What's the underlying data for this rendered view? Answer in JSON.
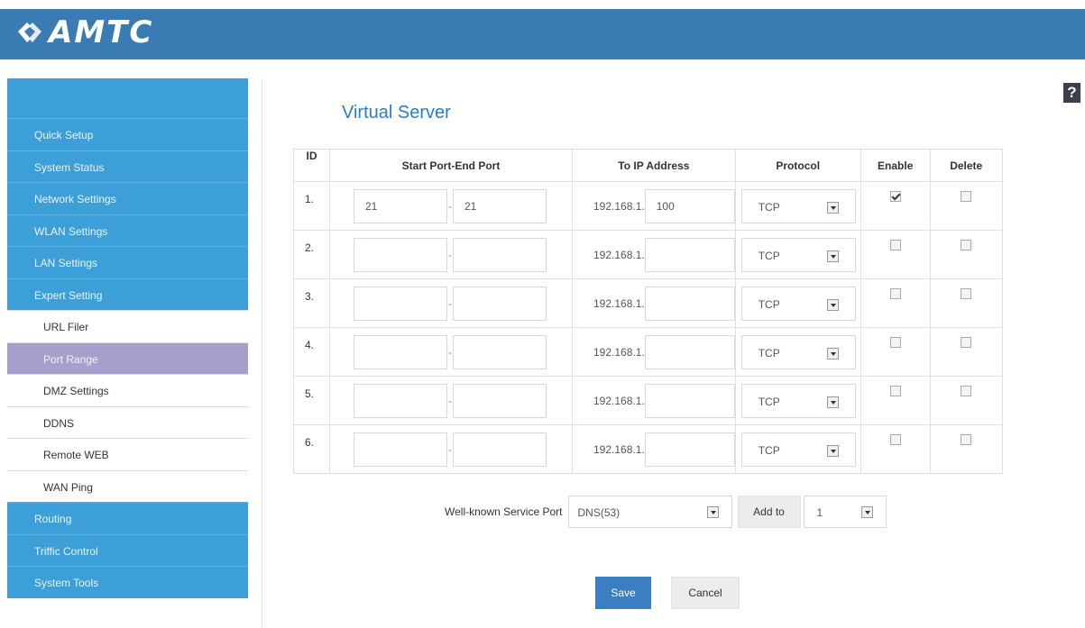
{
  "header": {
    "logo_text": "AMTC"
  },
  "sidebar": {
    "items": [
      {
        "label": "Quick Setup"
      },
      {
        "label": "System Status"
      },
      {
        "label": "Network Settings"
      },
      {
        "label": "WLAN Settings"
      },
      {
        "label": "LAN Settings"
      },
      {
        "label": "Expert Setting"
      }
    ],
    "sub_items": [
      {
        "label": "URL Filer"
      },
      {
        "label": "Port Range",
        "active": true
      },
      {
        "label": "DMZ Settings"
      },
      {
        "label": "DDNS"
      },
      {
        "label": "Remote WEB"
      },
      {
        "label": "WAN Ping"
      }
    ],
    "bottom_items": [
      {
        "label": "Routing"
      },
      {
        "label": "Triffic Control"
      },
      {
        "label": "System Tools"
      }
    ]
  },
  "main": {
    "help": "?",
    "title": "Virtual Server",
    "table": {
      "headers": [
        "ID",
        "Start Port-End Port",
        "To IP Address",
        "Protocol",
        "Enable",
        "Delete"
      ],
      "rows": [
        {
          "id": "1.",
          "start_port": "21",
          "end_port": "21",
          "ip_prefix": "192.168.1.",
          "ip_suffix": "100",
          "protocol": "TCP",
          "enabled": true,
          "delete": false
        },
        {
          "id": "2.",
          "start_port": "",
          "end_port": "",
          "ip_prefix": "192.168.1.",
          "ip_suffix": "",
          "protocol": "TCP",
          "enabled": false,
          "delete": false
        },
        {
          "id": "3.",
          "start_port": "",
          "end_port": "",
          "ip_prefix": "192.168.1.",
          "ip_suffix": "",
          "protocol": "TCP",
          "enabled": false,
          "delete": false
        },
        {
          "id": "4.",
          "start_port": "",
          "end_port": "",
          "ip_prefix": "192.168.1.",
          "ip_suffix": "",
          "protocol": "TCP",
          "enabled": false,
          "delete": false
        },
        {
          "id": "5.",
          "start_port": "",
          "end_port": "",
          "ip_prefix": "192.168.1.",
          "ip_suffix": "",
          "protocol": "TCP",
          "enabled": false,
          "delete": false
        },
        {
          "id": "6.",
          "start_port": "",
          "end_port": "",
          "ip_prefix": "192.168.1.",
          "ip_suffix": "",
          "protocol": "TCP",
          "enabled": false,
          "delete": false
        }
      ],
      "separator": "-"
    },
    "well_known": {
      "label": "Well-known Service Port",
      "selected": "DNS(53)",
      "add_label": "Add to",
      "target": "1"
    },
    "save_label": "Save",
    "cancel_label": "Cancel"
  },
  "colors": {
    "header": "#3a7bb3",
    "sidebar": "#3d9fd8",
    "active": "#a79fcb",
    "accent": "#2b7dc5"
  }
}
